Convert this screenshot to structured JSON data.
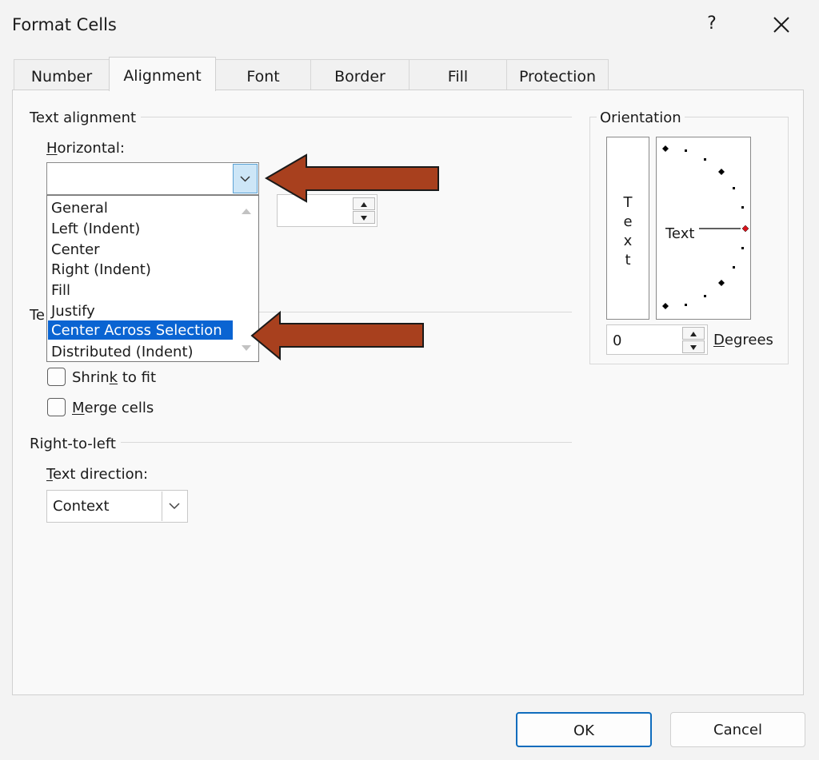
{
  "dialog": {
    "title": "Format Cells",
    "help_label": "?",
    "close_icon": "close-icon"
  },
  "tabs": [
    {
      "label": "Number",
      "active": false
    },
    {
      "label": "Alignment",
      "active": true
    },
    {
      "label": "Font",
      "active": false
    },
    {
      "label": "Border",
      "active": false
    },
    {
      "label": "Fill",
      "active": false
    },
    {
      "label": "Protection",
      "active": false
    }
  ],
  "text_alignment": {
    "group_label": "Text alignment",
    "horizontal": {
      "label_underlined": "H",
      "label_rest": "orizontal:",
      "value": "",
      "options": [
        "General",
        "Left (Indent)",
        "Center",
        "Right (Indent)",
        "Fill",
        "Justify",
        "Center Across Selection",
        "Distributed (Indent)"
      ],
      "selected": "Center Across Selection"
    },
    "indent_value": ""
  },
  "text_control": {
    "group_label_visible": "Te",
    "shrink": {
      "pre": "Shrin",
      "underlined": "k",
      "post": " to fit",
      "checked": false
    },
    "merge": {
      "pre": "",
      "underlined": "M",
      "post": "erge cells",
      "checked": false
    }
  },
  "rtl": {
    "group_label": "Right-to-left",
    "direction": {
      "underlined": "T",
      "rest": "ext direction:",
      "value": "Context"
    }
  },
  "orientation": {
    "group_label": "Orientation",
    "vertical_letters": [
      "T",
      "e",
      "x",
      "t"
    ],
    "dial_text": "Text",
    "degrees_value": "0",
    "degrees_label": {
      "underlined": "D",
      "rest": "egrees"
    }
  },
  "buttons": {
    "ok": "OK",
    "cancel": "Cancel"
  },
  "colors": {
    "annotation_arrow": "#a8401e",
    "selection": "#0a64d2",
    "dial_marker": "#d9121b"
  }
}
